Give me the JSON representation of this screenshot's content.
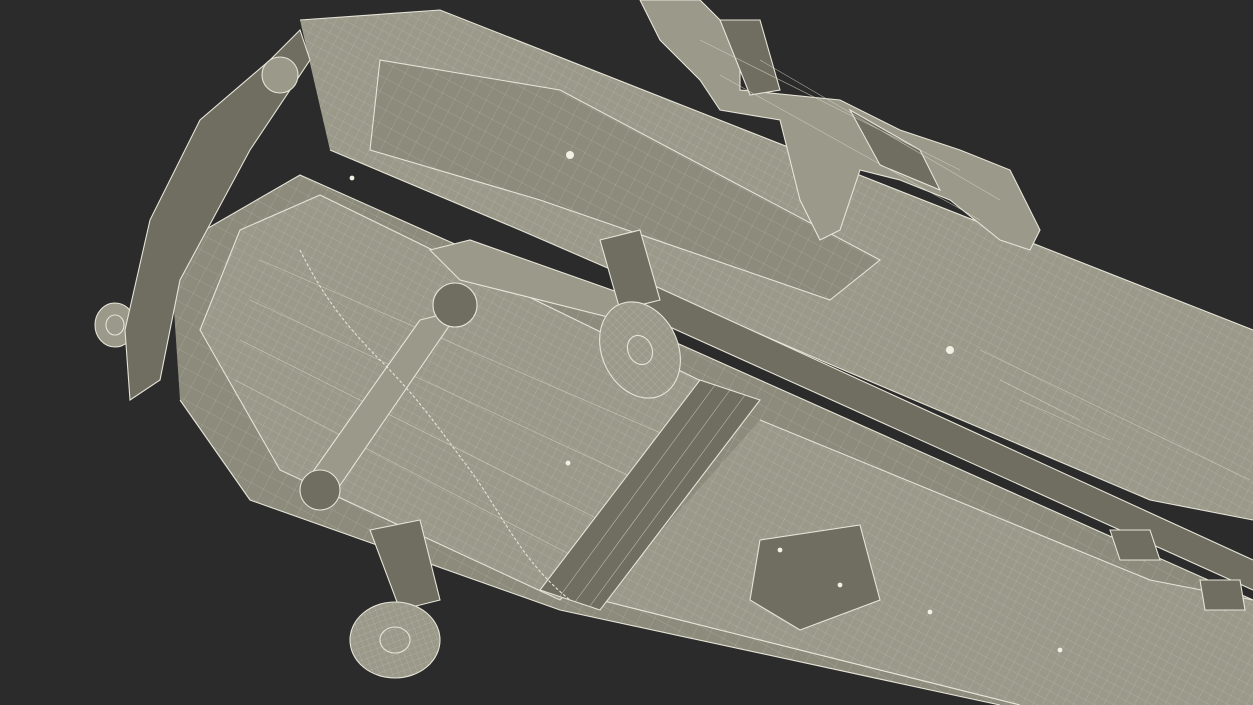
{
  "scene": {
    "subject": "hospital-bed-wireframe",
    "background_color": "#2b2b2b",
    "mesh_fill_color": "#8c8b7c",
    "wire_color": "#e6e4d6"
  }
}
